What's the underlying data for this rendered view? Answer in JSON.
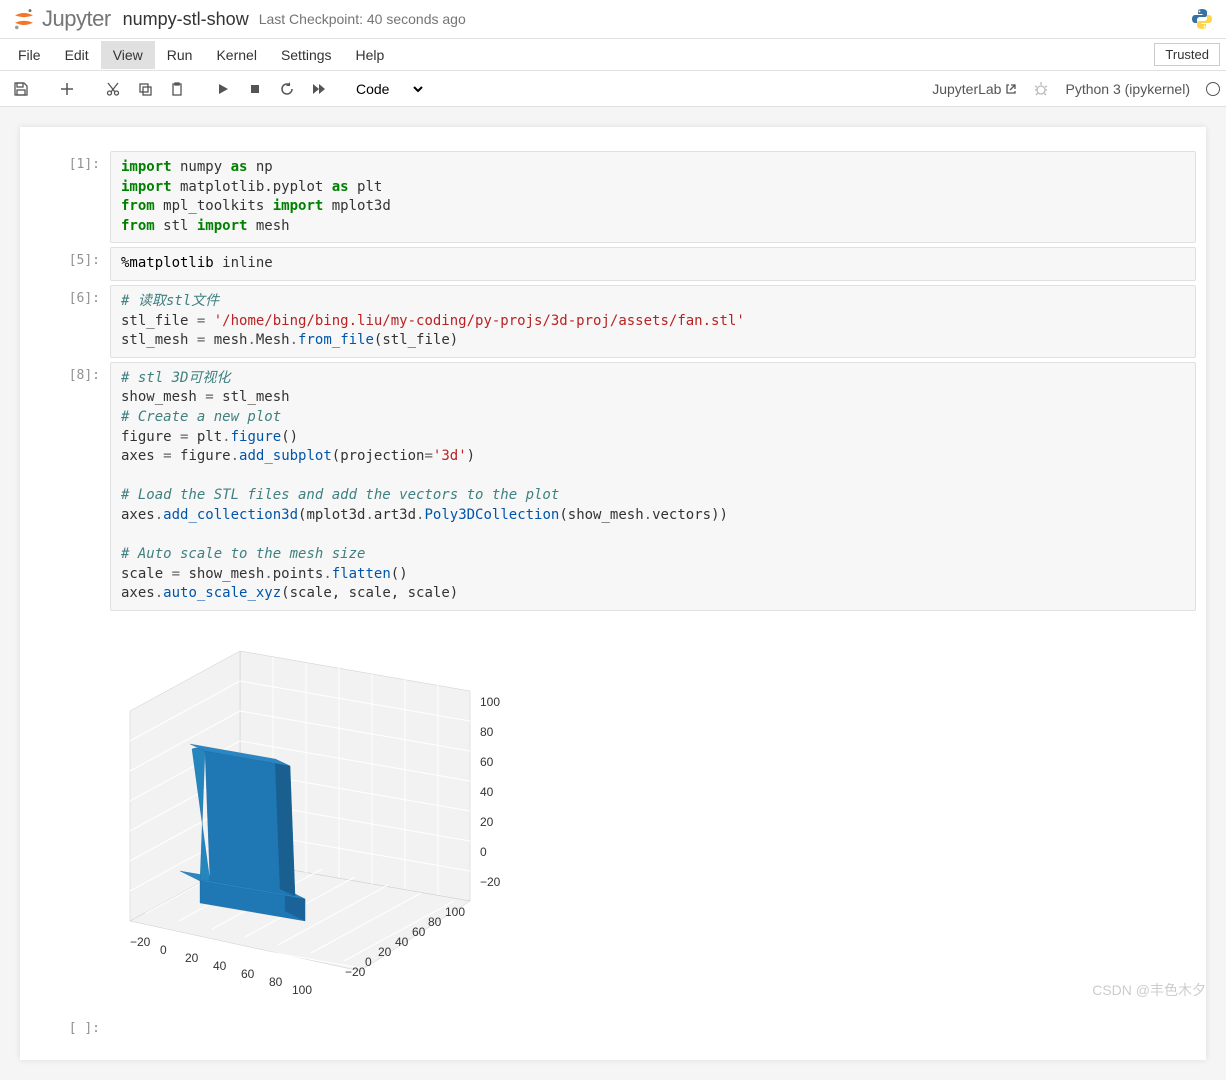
{
  "header": {
    "logo_text": "Jupyter",
    "notebook_name": "numpy-stl-show",
    "checkpoint": "Last Checkpoint: 40 seconds ago"
  },
  "menu": {
    "items": [
      "File",
      "Edit",
      "View",
      "Run",
      "Kernel",
      "Settings",
      "Help"
    ],
    "active_index": 2,
    "trusted": "Trusted"
  },
  "toolbar": {
    "cell_type": "Code",
    "jupyterlab": "JupyterLab",
    "kernel": "Python 3 (ipykernel)"
  },
  "cells": [
    {
      "prompt": "[1]:",
      "code_html": "<span class='kw'>import</span> numpy <span class='kw'>as</span> np\n<span class='kw'>import</span> matplotlib.pyplot <span class='kw'>as</span> plt\n<span class='kw'>from</span> mpl_toolkits <span class='kw'>import</span> mplot3d\n<span class='kw'>from</span> stl <span class='kw'>import</span> mesh"
    },
    {
      "prompt": "[5]:",
      "code_html": "<span class='mag'>%matplotlib</span> inline"
    },
    {
      "prompt": "[6]:",
      "code_html": "<span class='cmt'># 读取stl文件</span>\nstl_file <span class='op'>=</span> <span class='str'>'/home/bing/bing.liu/my-coding/py-projs/3d-proj/assets/fan.stl'</span>\nstl_mesh <span class='op'>=</span> mesh<span class='op'>.</span>Mesh<span class='op'>.</span><span class='fn'>from_file</span>(stl_file)"
    },
    {
      "prompt": "[8]:",
      "code_html": "<span class='cmt'># stl 3D可视化</span>\nshow_mesh <span class='op'>=</span> stl_mesh\n<span class='cmt'># Create a new plot</span>\nfigure <span class='op'>=</span> plt<span class='op'>.</span><span class='fn'>figure</span>()\naxes <span class='op'>=</span> figure<span class='op'>.</span><span class='fn'>add_subplot</span>(projection<span class='op'>=</span><span class='str'>'3d'</span>)\n\n<span class='cmt'># Load the STL files and add the vectors to the plot</span>\naxes<span class='op'>.</span><span class='fn'>add_collection3d</span>(mplot3d<span class='op'>.</span>art3d<span class='op'>.</span><span class='fn'>Poly3DCollection</span>(show_mesh<span class='op'>.</span>vectors))\n\n<span class='cmt'># Auto scale to the mesh size</span>\nscale <span class='op'>=</span> show_mesh<span class='op'>.</span>points<span class='op'>.</span><span class='fn'>flatten</span>()\naxes<span class='op'>.</span><span class='fn'>auto_scale_xyz</span>(scale, scale, scale)"
    }
  ],
  "chart_data": {
    "type": "3d",
    "x_ticks": [
      -20,
      0,
      20,
      40,
      60,
      80,
      100
    ],
    "y_ticks": [
      -20,
      0,
      20,
      40,
      60,
      80,
      100
    ],
    "z_ticks": [
      -20,
      0,
      20,
      40,
      60,
      80,
      100
    ],
    "mesh_color": "#1f77b4",
    "description": "3D mesh plot of STL fan model"
  },
  "watermark": "CSDN @丰色木夕"
}
